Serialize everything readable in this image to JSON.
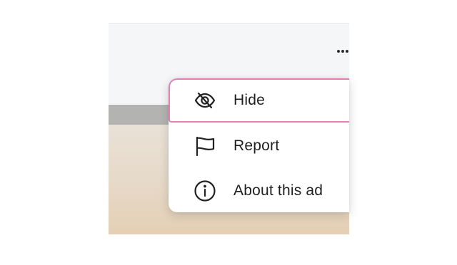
{
  "more_menu": {
    "trigger_icon": "more-horizontal-icon",
    "items": [
      {
        "label": "Hide",
        "icon": "eye-slash-icon",
        "focused": true
      },
      {
        "label": "Report",
        "icon": "flag-icon",
        "focused": false
      },
      {
        "label": "About this ad",
        "icon": "info-circle-icon",
        "focused": false
      }
    ]
  },
  "colors": {
    "focus_ring": "#e47fb4",
    "text": "#1f1f1f",
    "menu_background": "#ffffff",
    "backdrop": "#f5f6f7"
  }
}
